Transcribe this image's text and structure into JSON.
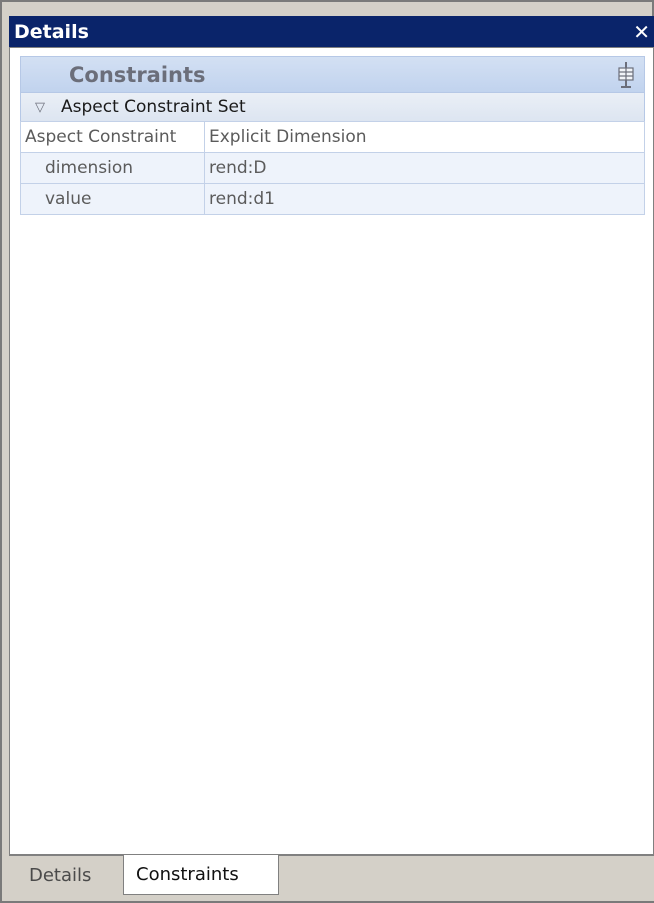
{
  "window": {
    "title": "Details"
  },
  "panel": {
    "title": "Constraints",
    "group": {
      "label": "Aspect Constraint Set",
      "header": {
        "name": "Aspect Constraint",
        "value": "Explicit Dimension"
      },
      "rows": [
        {
          "name": "dimension",
          "value": "rend:D"
        },
        {
          "name": "value",
          "value": "rend:d1"
        }
      ]
    }
  },
  "tabs": [
    {
      "label": "Details",
      "active": false
    },
    {
      "label": "Constraints",
      "active": true
    }
  ],
  "icons": {
    "close": "close-icon",
    "pin": "pin-icon",
    "expand": "collapse-triangle-icon"
  },
  "colors": {
    "titlebar": "#0a246a",
    "panel_header": "#c1d3ee",
    "row_bg": "#eef3fb"
  }
}
